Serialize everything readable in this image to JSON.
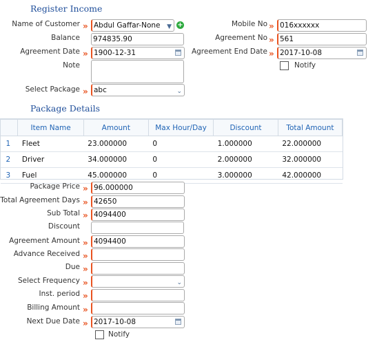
{
  "register_income": {
    "title": "Register Income",
    "customer": {
      "label": "Name of Customer",
      "value": "Abdul Gaffar-None"
    },
    "mobile": {
      "label": "Mobile No",
      "value": "016xxxxxx"
    },
    "balance": {
      "label": "Balance",
      "value": "974835.90"
    },
    "agreement_no": {
      "label": "Agreement No",
      "value": "561"
    },
    "agreement_date": {
      "label": "Agreement Date",
      "value": "1900-12-31"
    },
    "agreement_end_date": {
      "label": "Agreement End Date",
      "value": "2017-10-08"
    },
    "note": {
      "label": "Note",
      "value": ""
    },
    "notify_top": {
      "label": "Notify",
      "checked": false
    },
    "package": {
      "label": "Select Package",
      "value": "abc"
    }
  },
  "package_details": {
    "title": "Package Details",
    "columns": [
      "Item Name",
      "Amount",
      "Max Hour/Day",
      "Discount",
      "Total Amount"
    ],
    "rows": [
      {
        "n": "1",
        "item": "Fleet",
        "amount": "23.000000",
        "max": "0",
        "discount": "1.000000",
        "total": "22.000000"
      },
      {
        "n": "2",
        "item": "Driver",
        "amount": "34.000000",
        "max": "0",
        "discount": "2.000000",
        "total": "32.000000"
      },
      {
        "n": "3",
        "item": "Fuel",
        "amount": "45.000000",
        "max": "0",
        "discount": "3.000000",
        "total": "42.000000"
      }
    ]
  },
  "summary": {
    "package_price": {
      "label": "Package Price",
      "value": "96.000000"
    },
    "total_agreement_days": {
      "label": "Total Agreement Days",
      "value": "42650"
    },
    "sub_total": {
      "label": "Sub Total",
      "value": "4094400"
    },
    "discount": {
      "label": "Discount",
      "value": ""
    },
    "agreement_amount": {
      "label": "Agreement Amount",
      "value": "4094400"
    },
    "advance_received": {
      "label": "Advance Received",
      "value": ""
    },
    "due": {
      "label": "Due",
      "value": ""
    },
    "frequency": {
      "label": "Select Frequency",
      "value": ""
    },
    "inst_period": {
      "label": "Inst. period",
      "value": ""
    },
    "billing_amount": {
      "label": "Billing Amount",
      "value": ""
    },
    "next_due_date": {
      "label": "Next Due Date",
      "value": "2017-10-08"
    },
    "notify_bottom": {
      "label": "Notify",
      "checked": false
    }
  },
  "icons": {
    "required_marker": "»",
    "add": "+",
    "dropdown": "chevron-down-icon",
    "calendar": "calendar-icon"
  }
}
